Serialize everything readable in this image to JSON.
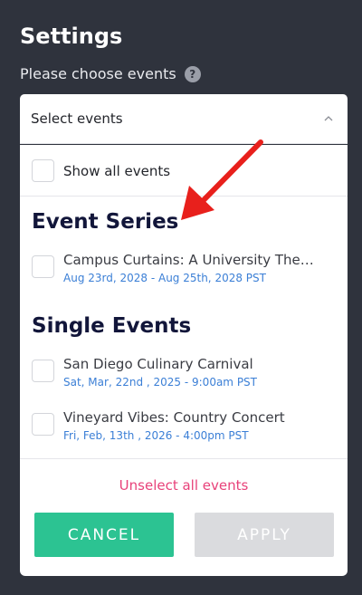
{
  "header": {
    "title": "Settings"
  },
  "prompt": {
    "text": "Please choose events",
    "help_icon": "?"
  },
  "select": {
    "text": "Select events",
    "icon": "chevron-up-icon"
  },
  "options": {
    "show_all_label": "Show all events"
  },
  "event_series": {
    "heading": "Event Series",
    "items": [
      {
        "name": "Campus Curtains: A University The…",
        "date": "Aug 23rd, 2028 - Aug 25th, 2028 PST"
      }
    ]
  },
  "single_events": {
    "heading": "Single Events",
    "items": [
      {
        "name": "San Diego Culinary Carnival",
        "date": "Sat, Mar, 22nd , 2025 - 9:00am PST"
      },
      {
        "name": "Vineyard Vibes: Country Concert",
        "date": "Fri, Feb, 13th , 2026 - 4:00pm PST"
      }
    ]
  },
  "actions": {
    "unselect_label": "Unselect all events",
    "cancel_label": "CANCEL",
    "apply_label": "APPLY"
  },
  "colors": {
    "background": "#2f333d",
    "accent_green": "#2cc392",
    "link_pink": "#e8427a",
    "date_blue": "#3b7fd6",
    "arrow_red": "#e8201c",
    "heading_navy": "#12163a"
  }
}
